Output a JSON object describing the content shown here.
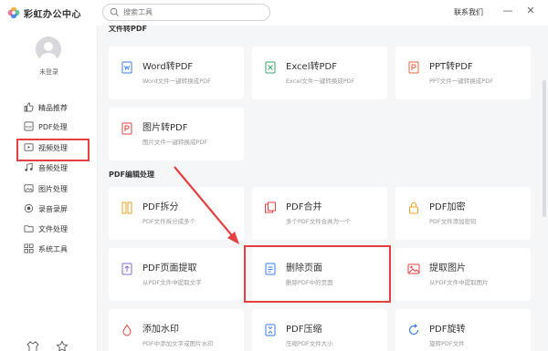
{
  "app": {
    "name": "彩虹办公中心",
    "contact_label": "联系我们",
    "minimize": "—",
    "close": "✕"
  },
  "search": {
    "placeholder": "搜索工具"
  },
  "user": {
    "status": "未登录"
  },
  "sidebar": {
    "items": [
      {
        "label": "精品推荐",
        "icon": "thumbs-up-icon"
      },
      {
        "label": "PDF处理",
        "icon": "pdf-icon",
        "active": true
      },
      {
        "label": "视频处理",
        "icon": "video-icon"
      },
      {
        "label": "音频处理",
        "icon": "music-icon"
      },
      {
        "label": "图片处理",
        "icon": "image-icon"
      },
      {
        "label": "录音录屏",
        "icon": "record-icon"
      },
      {
        "label": "文件处理",
        "icon": "folder-icon"
      },
      {
        "label": "系统工具",
        "icon": "grid-icon"
      }
    ]
  },
  "sections": {
    "convert": {
      "title": "文件转PDF"
    },
    "edit": {
      "title": "PDF编辑处理"
    }
  },
  "cards": {
    "word": {
      "title": "Word转PDF",
      "desc": "Word文件一键转换成PDF",
      "icon": "word-icon"
    },
    "excel": {
      "title": "Excel转PDF",
      "desc": "Excel文件一键转换成PDF",
      "icon": "excel-icon"
    },
    "ppt": {
      "title": "PPT转PDF",
      "desc": "PPT文件一键转换成PDF",
      "icon": "ppt-icon"
    },
    "image": {
      "title": "图片转PDF",
      "desc": "图片文件一键转换成PDF",
      "icon": "image-to-pdf-icon"
    },
    "split": {
      "title": "PDF拆分",
      "desc": "PDF文件拆分成多个",
      "icon": "split-icon"
    },
    "merge": {
      "title": "PDF合并",
      "desc": "多个PDF文件合并为一个",
      "icon": "merge-icon"
    },
    "encrypt": {
      "title": "PDF加密",
      "desc": "PDF文件添加密码",
      "icon": "lock-icon"
    },
    "extract_page": {
      "title": "PDF页面提取",
      "desc": "从PDF文件中提取文字",
      "icon": "upload-icon"
    },
    "delete_page": {
      "title": "删除页面",
      "desc": "删除PDF中的页面",
      "icon": "delete-page-icon",
      "highlighted": true
    },
    "extract_image": {
      "title": "提取图片",
      "desc": "从PDF文件中提取图片",
      "icon": "picture-icon"
    },
    "watermark": {
      "title": "添加水印",
      "desc": "PDF中添加文字或图片水印",
      "icon": "watermark-icon"
    },
    "compress": {
      "title": "PDF压缩",
      "desc": "压缩PDF文件大小",
      "icon": "compress-icon"
    },
    "rotate": {
      "title": "PDF旋转",
      "desc": "旋转PDF文件",
      "icon": "rotate-icon"
    }
  },
  "colors": {
    "accent": "#e54040",
    "brand_blue": "#3b7ee8",
    "sidebar_bg": "#ffffff",
    "content_bg": "#f5f6f8"
  }
}
